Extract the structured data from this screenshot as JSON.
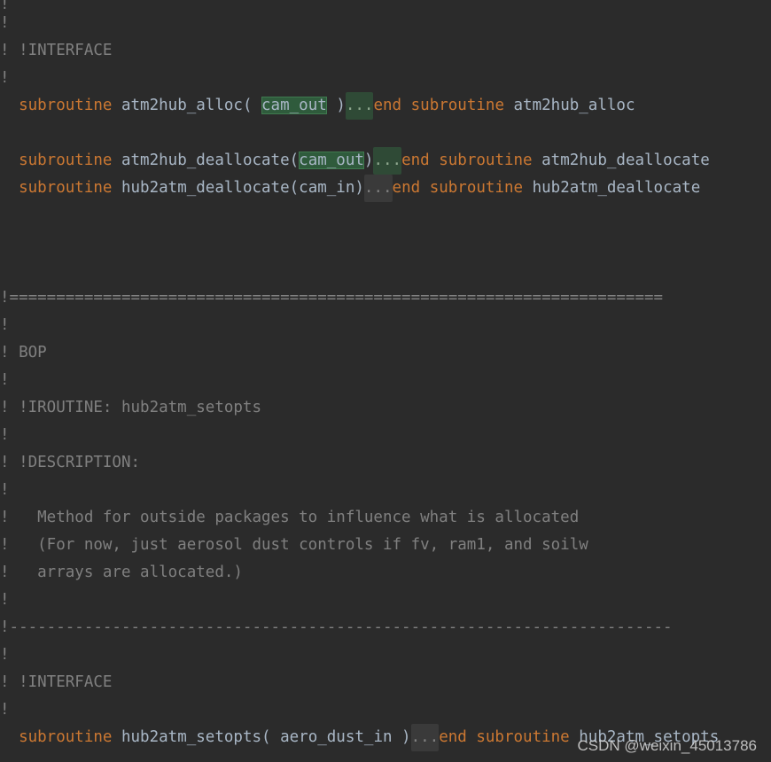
{
  "code": {
    "l0": "!",
    "l1": "!",
    "l2": "! !INTERFACE",
    "l3": "!",
    "l4": {
      "kw1": "subroutine",
      "name1": " atm2hub_alloc( ",
      "arg": "cam_out",
      "close": " )",
      "fold": "...",
      "kw2": "end",
      "kw3": "subroutine",
      "name2": " atm2hub_alloc"
    },
    "l6": {
      "kw1": "subroutine",
      "name1": " atm2hub_deallocate(",
      "arg": "cam_out",
      "close": ")",
      "fold": "...",
      "kw2": "end",
      "kw3": "subroutine",
      "name2": " atm2hub_deallocate"
    },
    "l7": {
      "kw1": "subroutine",
      "name1": " hub2atm_deallocate(cam_in)",
      "fold": "...",
      "kw2": "end",
      "kw3": "subroutine",
      "name2": " hub2atm_deallocate"
    },
    "l11": "!======================================================================",
    "l12": "!",
    "l13": "! BOP",
    "l14": "!",
    "l15": "! !IROUTINE: hub2atm_setopts",
    "l16": "!",
    "l17": "! !DESCRIPTION:",
    "l18": "!",
    "l19": "!   Method for outside packages to influence what is allocated",
    "l20": "!   (For now, just aerosol dust controls if fv, ram1, and soilw",
    "l21": "!   arrays are allocated.)",
    "l22": "!",
    "l23": "!-----------------------------------------------------------------------",
    "l24": "!",
    "l25": "! !INTERFACE",
    "l26": "!",
    "l27": {
      "kw1": "subroutine",
      "name1": " hub2atm_setopts( aero_dust_in )",
      "fold": "...",
      "kw2": "end",
      "kw3": "subroutine",
      "name2": " hub2atm_setopts"
    }
  },
  "watermark": "CSDN @weixin_45013786",
  "colors": {
    "background": "#2b2b2b",
    "comment": "#808080",
    "keyword": "#cc7832",
    "identifier": "#a9b7c6",
    "highlight": "#2f5b3c"
  }
}
